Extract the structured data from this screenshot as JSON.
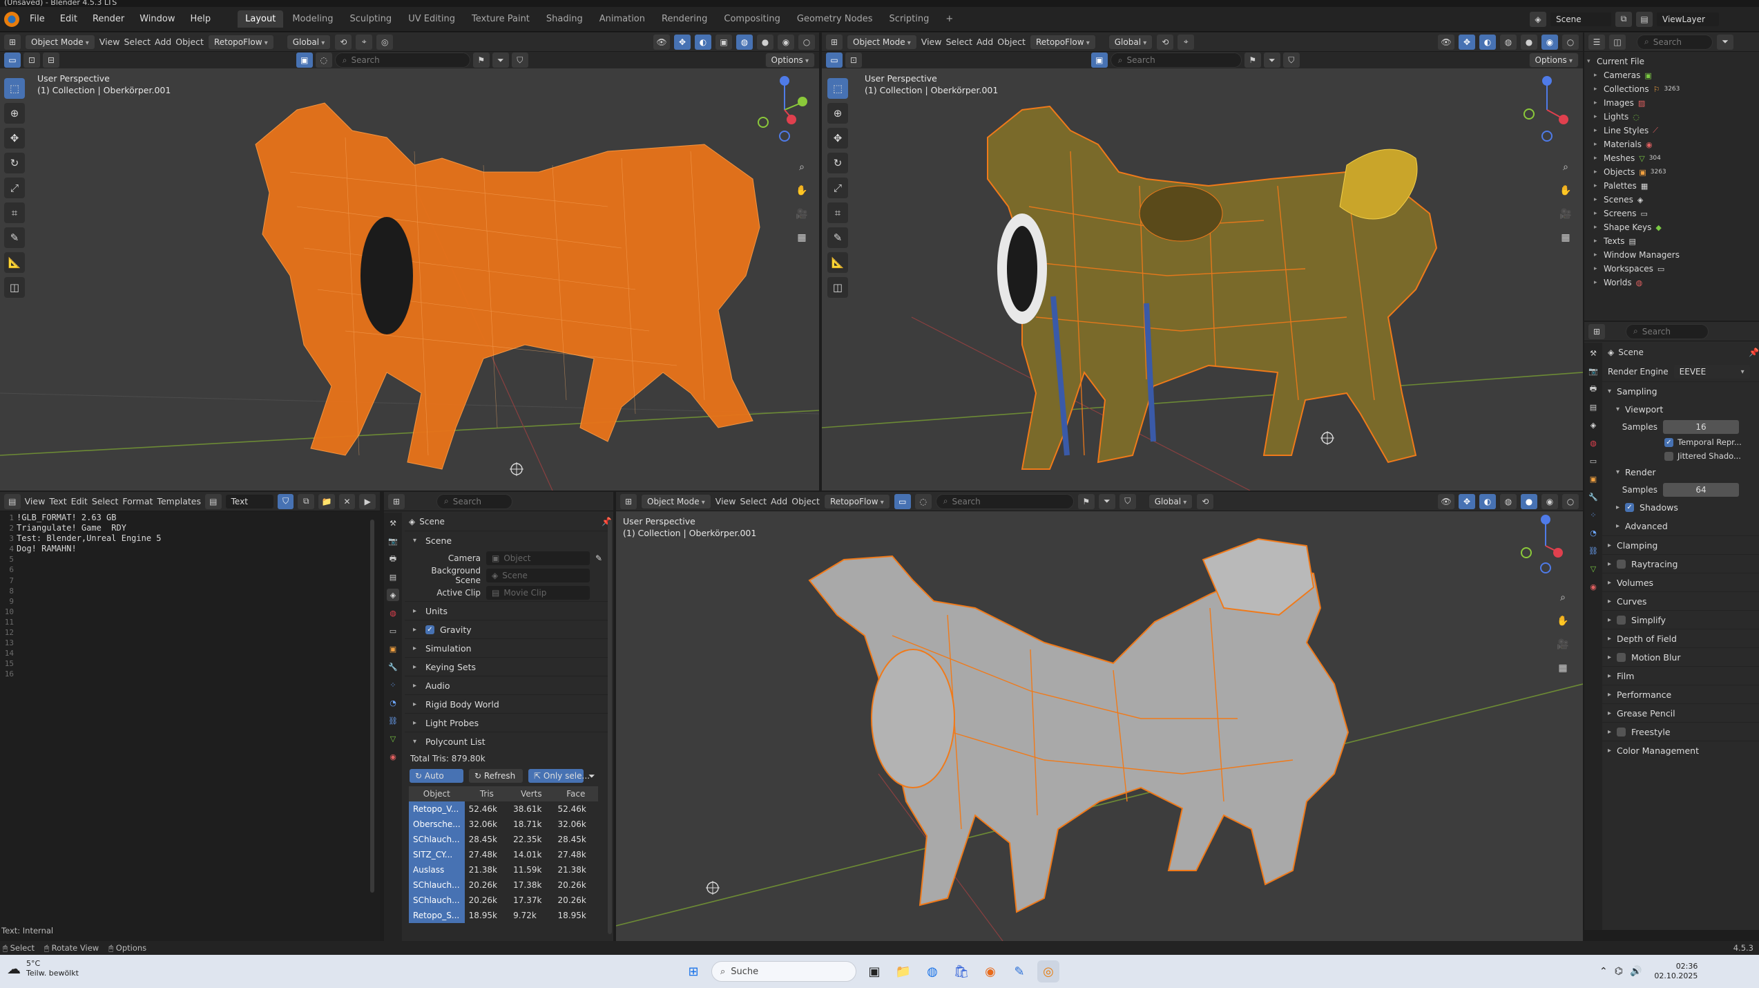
{
  "window": {
    "title": "(Unsaved) - Blender 4.5.3 LTS"
  },
  "menu": [
    "File",
    "Edit",
    "Render",
    "Window",
    "Help"
  ],
  "workspaces": [
    "Layout",
    "Modeling",
    "Sculpting",
    "UV Editing",
    "Texture Paint",
    "Shading",
    "Animation",
    "Rendering",
    "Compositing",
    "Geometry Nodes",
    "Scripting"
  ],
  "scene_label": "Scene",
  "viewlayer_label": "ViewLayer",
  "viewport": {
    "mode": "Object Mode",
    "menus": [
      "View",
      "Select",
      "Add",
      "Object"
    ],
    "addon": "RetopoFlow",
    "transform": "Global",
    "options": "Options",
    "search_placeholder": "Search",
    "perspective": "User Perspective",
    "collection": "(1) Collection | Oberkörper.001"
  },
  "text_editor": {
    "menus": [
      "View",
      "Text",
      "Edit",
      "Select",
      "Format",
      "Templates"
    ],
    "datablock": "Text",
    "lines": [
      "",
      "",
      "!GLB_FORMAT! 2.63 GB",
      "",
      "",
      "Triangulate! Game  RDY",
      "Test: Blender,Unreal Engine 5",
      "",
      "",
      "Dog! RAMAHN!",
      "",
      "",
      "",
      "",
      "",
      ""
    ],
    "status": "Text: Internal"
  },
  "props_mid": {
    "search_placeholder": "Search",
    "context": "Scene",
    "panel_scene": "Scene",
    "camera_label": "Camera",
    "camera_value": "Object",
    "bg_scene_label": "Background Scene",
    "bg_scene_value": "Scene",
    "active_clip_label": "Active Clip",
    "active_clip_value": "Movie Clip",
    "panels": [
      "Units",
      "Gravity",
      "Simulation",
      "Keying Sets",
      "Audio",
      "Rigid Body World",
      "Light Probes",
      "Polycount List"
    ],
    "total_tris": "Total Tris: 879.80k",
    "btn_auto": "Auto",
    "btn_refresh": "Refresh",
    "btn_only": "Only sele...",
    "table_headers": [
      "Object",
      "Tris",
      "Verts",
      "Face"
    ],
    "table_rows": [
      [
        "Retopo_V...",
        "52.46k",
        "38.61k",
        "52.46k"
      ],
      [
        "Obersche...",
        "32.06k",
        "18.71k",
        "32.06k"
      ],
      [
        "SChlauch...",
        "28.45k",
        "22.35k",
        "28.45k"
      ],
      [
        "SITZ_CY...",
        "27.48k",
        "14.01k",
        "27.48k"
      ],
      [
        "Auslass",
        "21.38k",
        "11.59k",
        "21.38k"
      ],
      [
        "SChlauch...",
        "20.26k",
        "17.38k",
        "20.26k"
      ],
      [
        "SChlauch...",
        "20.26k",
        "17.37k",
        "20.26k"
      ],
      [
        "Retopo_S...",
        "18.95k",
        "9.72k",
        "18.95k"
      ]
    ]
  },
  "outliner": {
    "search_placeholder": "Search",
    "root": "Current File",
    "items": [
      "Cameras",
      "Collections",
      "Images",
      "Lights",
      "Line Styles",
      "Materials",
      "Meshes",
      "Objects",
      "Palettes",
      "Scenes",
      "Screens",
      "Shape Keys",
      "Texts",
      "Window Managers",
      "Workspaces",
      "Worlds"
    ],
    "badges": {
      "collections": "3263",
      "meshes": "304",
      "objects": "3263"
    }
  },
  "props_right": {
    "search_placeholder": "Search",
    "context": "Scene",
    "render_engine_label": "Render Engine",
    "render_engine_value": "EEVEE",
    "sampling": "Sampling",
    "viewport": "Viewport",
    "samples_label": "Samples",
    "viewport_samples": "16",
    "temporal": "Temporal Repr...",
    "jittered": "Jittered Shado...",
    "render": "Render",
    "render_samples": "64",
    "shadows": "Shadows",
    "advanced": "Advanced",
    "panels": [
      "Clamping",
      "Raytracing",
      "Volumes",
      "Curves",
      "Simplify",
      "Depth of Field",
      "Motion Blur",
      "Film",
      "Performance",
      "Grease Pencil",
      "Freestyle",
      "Color Management"
    ]
  },
  "statusbar": {
    "select": "Select",
    "rotate": "Rotate View",
    "options": "Options",
    "version": "4.5.3"
  },
  "taskbar": {
    "weather_temp": "5°C",
    "weather_desc": "Teilw. bewölkt",
    "search": "Suche",
    "time": "02:36",
    "date": "02.10.2025"
  },
  "colors": {
    "accent": "#4772b3",
    "selection_orange": "#f07a1a",
    "viewport_bg": "#3d3d3d"
  }
}
